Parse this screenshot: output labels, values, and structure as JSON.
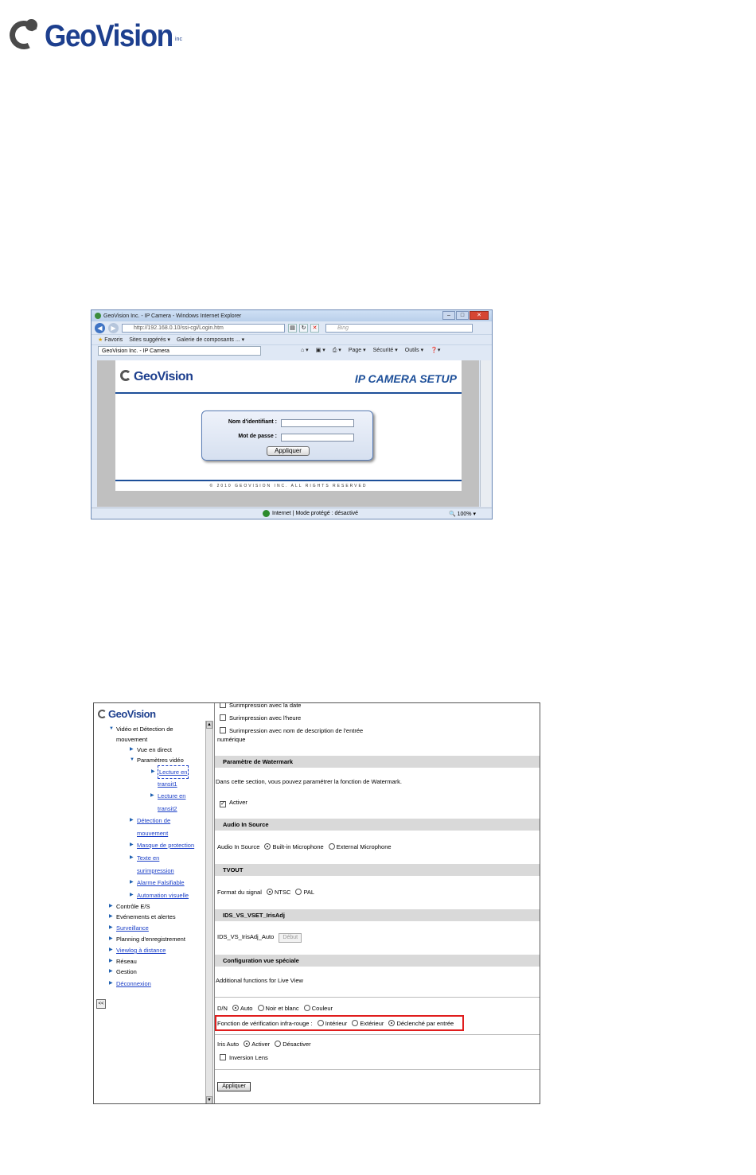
{
  "logo": {
    "brand": "GeoVision",
    "suffix": "inc"
  },
  "browser": {
    "window_title": "GeoVision Inc. - IP Camera - Windows Internet Explorer",
    "url": "http://192.168.0.10/ssi-cgi/Login.htm",
    "search_placeholder": "Bing",
    "favorites": "Favoris",
    "suggested_sites": "Sites suggérés ▾",
    "gallery": "Galerie de composants ... ▾",
    "tab_title": "GeoVision Inc. - IP Camera",
    "commands": [
      "Page ▾",
      "Sécurité ▾",
      "Outils ▾",
      "❓▾"
    ],
    "status_zone": "Internet | Mode protégé : désactivé",
    "zoom": "100%",
    "page": {
      "logo_text": "GeoVision",
      "heading": "IP CAMERA SETUP",
      "username_label": "Nom d'identifiant :",
      "password_label": "Mot de passe :",
      "apply_label": "Appliquer",
      "footer": "© 2010 GEOVISION INC. ALL RIGHTS RESERVED"
    }
  },
  "config": {
    "logo_text": "GeoVision",
    "nav": {
      "video_motion": "Vidéo et Détection de",
      "video_motion_2": "mouvement",
      "live_view": "Vue en direct",
      "video_settings": "Paramètres vidéo",
      "stream1_a": "Lecture en",
      "stream1_b": "transit1",
      "stream2_a": "Lecture en",
      "stream2_b": "transit2",
      "motion_a": "Détection de",
      "motion_b": "mouvement",
      "privacy_mask": "Masque de protection",
      "text_a": "Texte en",
      "text_b": "surimpression",
      "tampering": "Alarme Falsifiable",
      "visual_auto": "Automation visuelle",
      "io_control": "Contrôle E/S",
      "events": "Evénements et alertes",
      "monitoring": "Surveillance",
      "recording": "Planning d'enregistrement",
      "viewlog": "Viewlog à distance",
      "network": "Réseau",
      "management": "Gestion",
      "logout": "Déconnexion",
      "collapse": "<<"
    },
    "overlay_date": "Surimpression avec la date",
    "overlay_time": "Surimpression avec l'heure",
    "overlay_name_a": "Surimpression avec nom de description de l'entrée",
    "overlay_name_b": "numérique",
    "watermark_head": "Paramètre de Watermark",
    "watermark_desc": "Dans cette section, vous pouvez paramétrer la fonction de Watermark.",
    "watermark_enable": "Activer",
    "audio_head": "Audio In Source",
    "audio_label": "Audio In Source",
    "audio_builtin": "Built-in Microphone",
    "audio_external": "External Microphone",
    "tvout_head": "TVOUT",
    "signal_label": "Format du signal",
    "ntsc": "NTSC",
    "pal": "PAL",
    "iris_head": "IDS_VS_VSET_IrisAdj",
    "iris_label": "IDS_VS_IrisAdj_Auto",
    "iris_btn": "Début",
    "special_head": "Configuration vue spéciale",
    "special_desc": "Additional functions for Live View",
    "dn_label": "D/N",
    "dn_auto": "Auto",
    "dn_bw": "Noir et blanc",
    "dn_color": "Couleur",
    "ir_label": "Fonction de vérification infra-rouge :",
    "ir_indoor": "Intérieur",
    "ir_outdoor": "Extérieur",
    "ir_trigger": "Déclenché par entrée",
    "iris_auto_label": "Iris Auto",
    "iris_on": "Activer",
    "iris_off": "Désactiver",
    "lens_reverse": "Inversion Lens",
    "apply": "Appliquer"
  }
}
